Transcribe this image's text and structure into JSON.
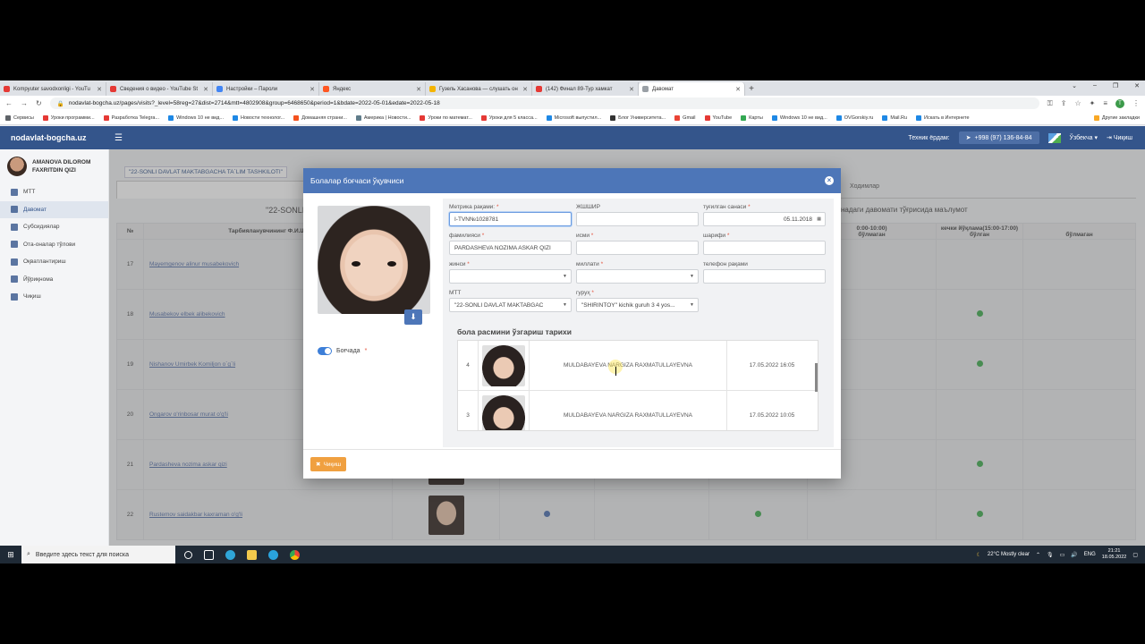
{
  "browser": {
    "tabs": [
      {
        "title": "Kompyuter savodxonligi - YouTu",
        "color": "#e53935"
      },
      {
        "title": "Сведения о видео - YouTube St",
        "color": "#e53935"
      },
      {
        "title": "Настройки – Пароли",
        "color": "#4285f4"
      },
      {
        "title": "Яндекс",
        "color": "#ff5722"
      },
      {
        "title": "Гузель Хасанова — слушать он",
        "color": "#f4b400"
      },
      {
        "title": "(142) Финал 89-Тур хамкат",
        "color": "#e53935"
      },
      {
        "title": "Давомат",
        "color": "#9aa0a6",
        "active": true
      }
    ],
    "url": "nodavlat-bogcha.uz/pages/visits?_level=58reg=27&dist=2714&mtt=4802908&group=6468650&period=1&bdate=2022-05-01&edate=2022-05-18",
    "bookmarks": [
      {
        "label": "Сервисы",
        "color": "#5f6368"
      },
      {
        "label": "Уроки программи...",
        "color": "#e53935"
      },
      {
        "label": "Разработка Telegra...",
        "color": "#e53935"
      },
      {
        "label": "Windows 10 не вид...",
        "color": "#1e88e5"
      },
      {
        "label": "Новости технолог...",
        "color": "#1e88e5"
      },
      {
        "label": "Домашняя страни...",
        "color": "#f4511e"
      },
      {
        "label": "Америка | Новости...",
        "color": "#607d8b"
      },
      {
        "label": "Уроки по математ...",
        "color": "#e53935"
      },
      {
        "label": "Уроки для 5 класса...",
        "color": "#e53935"
      },
      {
        "label": "Microsoft выпустил...",
        "color": "#1e88e5"
      },
      {
        "label": "Блог Университета...",
        "color": "#333333"
      },
      {
        "label": "Gmail",
        "color": "#ea4335"
      },
      {
        "label": "YouTube",
        "color": "#e53935"
      },
      {
        "label": "Карты",
        "color": "#34a853"
      },
      {
        "label": "Windows 10 не вид...",
        "color": "#1e88e5"
      },
      {
        "label": "OVGorskiy.ru",
        "color": "#1e88e5"
      },
      {
        "label": "Mail.Ru",
        "color": "#1e88e5"
      },
      {
        "label": "Искать в Интернете",
        "color": "#1e88e5"
      },
      {
        "label": "Другие закладки",
        "color": "#f9a825"
      }
    ],
    "profile_initial": "T"
  },
  "app": {
    "brand": "nodavlat-bogcha.uz",
    "support_label": "Техник ёрдам:",
    "phone": "+998 (97) 136-84-84",
    "language": "Ўзбекча",
    "exit": "Чиқиш",
    "user_name": "AMANOVA DILOROM FAXRITDIN QIZI",
    "menu": [
      {
        "label": "МТТ",
        "active": false
      },
      {
        "label": "Давомат",
        "active": true
      },
      {
        "label": "Субсидиялар",
        "active": false
      },
      {
        "label": "Ота-оналар тўлови",
        "active": false
      },
      {
        "label": "Оқватлантириш",
        "active": false
      },
      {
        "label": "Йўриқнома",
        "active": false
      },
      {
        "label": "Чиқиш",
        "active": false
      }
    ]
  },
  "background": {
    "org_label": "\"22-SONLI DAVLAT MAKTABGACHA TA`LIM TASHKILOTI\"",
    "tab_staff": "Ходимлар",
    "title_left": "\"22-SONLI",
    "title_right": "надаги давомати тўғрисида маълумот",
    "col_no": "№",
    "col_name": "Тарбияланувчининг Ф.И.Ш.",
    "col_time1": "0:00-10:00)",
    "col_time2": "кечки йўқлама(15:00-17:00)",
    "col_missing": "бўлмаган",
    "col_present": "бўлган",
    "rows": [
      {
        "n": "17",
        "name": "Mayemgenov alinur musabekovich",
        "check_a": false,
        "check_b": false
      },
      {
        "n": "18",
        "name": "Musabekov elbek alibekovich",
        "check_a": false,
        "check_b": true
      },
      {
        "n": "19",
        "name": "Nishanov Umirbek Komiljon o`g`li",
        "check_a": false,
        "check_b": true
      },
      {
        "n": "20",
        "name": "Ongarov o'rinbosar murat o'g'li",
        "check_a": false,
        "check_b": false
      },
      {
        "n": "21",
        "name": "Pardasheva nozima askar qizi",
        "check_a": false,
        "check_b": true
      },
      {
        "n": "22",
        "name": "Rustemov saidakbar kaxraman o'g'li",
        "check_a": true,
        "check_b": true
      }
    ]
  },
  "modal": {
    "title": "Болалар боғчаси ўқувчиси",
    "toggle_label": "Боғчада",
    "fields": {
      "metrika_label": "Метрика рақами:",
      "metrika_value": "I-TVN№1028781",
      "jshshir_label": "ЖШШИР",
      "jshshir_value": "",
      "birth_label": "туғилган санаси",
      "birth_value": "05.11.2018",
      "surname_label": "фамилияси",
      "surname_value": "PARDASHEVA NOZIMA ASKAR QIZI",
      "name_label": "исми",
      "name_value": "",
      "patronymic_label": "шарифи",
      "patronymic_value": "",
      "gender_label": "жинси",
      "gender_value": "",
      "nation_label": "миллати",
      "nation_value": "",
      "phone_label": "телефон рақами",
      "phone_value": "",
      "mtt_label": "МТТ",
      "mtt_value": "\"22-SONLI DAVLAT MAKTABGAC",
      "group_label": "гуруҳ",
      "group_value": "\"SHIRINTOY\" kichik guruh 3 4 yos..."
    },
    "history_title": "бола расмини ўзгариш тарихи",
    "history": [
      {
        "n": "4",
        "name": "MULDABAYEVA NARGIZA RAXMATULLAYEVNA",
        "date": "17.05.2022 16:05"
      },
      {
        "n": "3",
        "name": "MULDABAYEVA NARGIZA RAXMATULLAYEVNA",
        "date": "17.05.2022 10:05"
      }
    ],
    "close_label": "Чиқиш"
  },
  "taskbar": {
    "search_placeholder": "Введите здесь текст для поиска",
    "weather": "22°C  Mostly clear",
    "lang": "ENG",
    "time": "21:21",
    "date": "18.05.2022"
  }
}
